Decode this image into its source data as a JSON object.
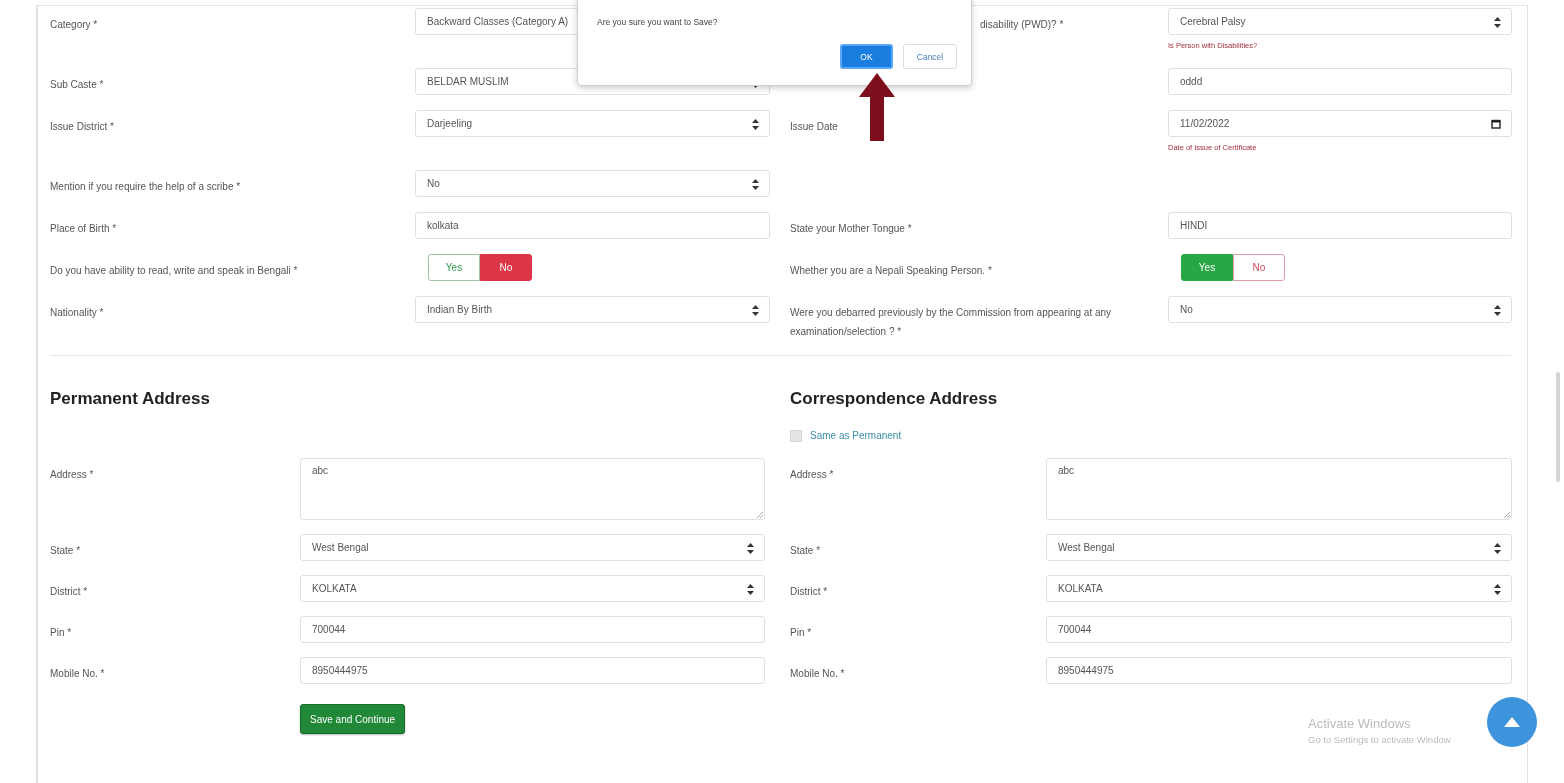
{
  "dialog": {
    "message": "Are you sure you want to Save?",
    "ok": "OK",
    "cancel": "Cancel"
  },
  "rows": [
    {
      "left": {
        "label": "Category *",
        "kind": "select",
        "value": "Backward Classes (Category A)"
      },
      "right": {
        "label": "disability (PWD)? *",
        "kind": "select",
        "value": "Cerebral Palsy",
        "hint": "Is Person with Disabilities?"
      }
    },
    {
      "left": {
        "label": "Sub Caste *",
        "kind": "select",
        "value": "BELDAR MUSLIM"
      },
      "right": {
        "kind": "text",
        "value": "oddd"
      }
    },
    {
      "left": {
        "label": "Issue District *",
        "kind": "select",
        "value": "Darjeeling"
      },
      "right": {
        "label": "Issue Date",
        "kind": "date",
        "value": "11/02/2022",
        "hint": "Date of Issue of Certificate"
      }
    },
    {
      "left": {
        "label": "Mention if you require the help of a scribe *",
        "kind": "select",
        "value": "No"
      }
    },
    {
      "left": {
        "label": "Place of Birth *",
        "kind": "text",
        "value": "kolkata"
      },
      "right": {
        "label": "State your Mother Tongue *",
        "kind": "text",
        "value": "HINDI"
      }
    },
    {
      "left": {
        "label": "Do you have ability to read, write and speak in Bengali *",
        "kind": "toggle",
        "options": [
          {
            "label": "Yes",
            "kind": "positive",
            "selected": false
          },
          {
            "label": "No",
            "kind": "negative",
            "selected": true
          }
        ]
      },
      "right": {
        "label": "Whether you are a Nepali Speaking Person. *",
        "kind": "toggle",
        "options": [
          {
            "label": "Yes",
            "kind": "positive",
            "selected": true
          },
          {
            "label": "No",
            "kind": "negative",
            "selected": false
          }
        ]
      }
    },
    {
      "left": {
        "label": "Nationality *",
        "kind": "select",
        "value": "Indian By Birth"
      },
      "right": {
        "label": "Were you debarred previously by the Commission from appearing at any examination/selection ? *",
        "kind": "select",
        "value": "No"
      }
    }
  ],
  "addresses": [
    {
      "title": "Permanent Address",
      "fields": [
        {
          "label": "Address *",
          "kind": "textarea",
          "value": "abc"
        },
        {
          "label": "State *",
          "kind": "select",
          "value": "West Bengal"
        },
        {
          "label": "District *",
          "kind": "select",
          "value": "KOLKATA"
        },
        {
          "label": "Pin *",
          "kind": "text",
          "value": "700044"
        },
        {
          "label": "Mobile No. *",
          "kind": "text",
          "value": "8950444975"
        }
      ]
    },
    {
      "title": "Correspondence Address",
      "same_as": {
        "label": "Same as Permanent",
        "checked": false
      },
      "fields": [
        {
          "label": "Address *",
          "kind": "textarea",
          "value": "abc"
        },
        {
          "label": "State *",
          "kind": "select",
          "value": "West Bengal"
        },
        {
          "label": "District *",
          "kind": "select",
          "value": "KOLKATA"
        },
        {
          "label": "Pin *",
          "kind": "text",
          "value": "700044"
        },
        {
          "label": "Mobile No. *",
          "kind": "text",
          "value": "8950444975"
        }
      ]
    }
  ],
  "save_button": "Save and Continue",
  "os_notice": {
    "title": "Activate Windows",
    "text": "Go to Settings to activate Window"
  }
}
